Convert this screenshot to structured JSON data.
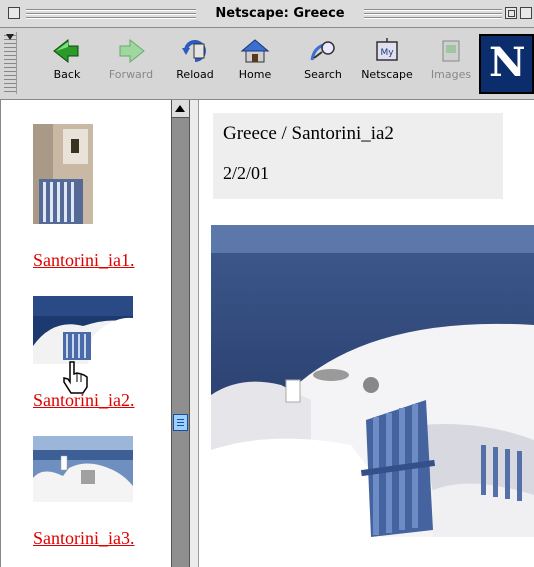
{
  "window": {
    "title": "Netscape: Greece"
  },
  "toolbar": {
    "buttons": [
      {
        "label": "Back",
        "icon": "back-arrow-icon",
        "enabled": true
      },
      {
        "label": "Forward",
        "icon": "forward-arrow-icon",
        "enabled": false
      },
      {
        "label": "Reload",
        "icon": "reload-icon",
        "enabled": true
      },
      {
        "label": "Home",
        "icon": "home-icon",
        "enabled": true
      },
      {
        "label": "Search",
        "icon": "search-icon",
        "enabled": true
      },
      {
        "label": "Netscape",
        "icon": "my-netscape-icon",
        "enabled": true
      },
      {
        "label": "Images",
        "icon": "images-icon",
        "enabled": false
      }
    ],
    "logo_letter": "N"
  },
  "left_frame": {
    "thumbnails": [
      {
        "label": "Santorini_ia1."
      },
      {
        "label": "Santorini_ia2."
      },
      {
        "label": "Santorini_ia3."
      }
    ]
  },
  "content": {
    "heading": "Greece / Santorini_ia2",
    "date": "2/2/01"
  },
  "colors": {
    "link": "#e00000",
    "logo_bg": "#0b2d6b",
    "scroll_thumb": "#9bd0ff"
  }
}
